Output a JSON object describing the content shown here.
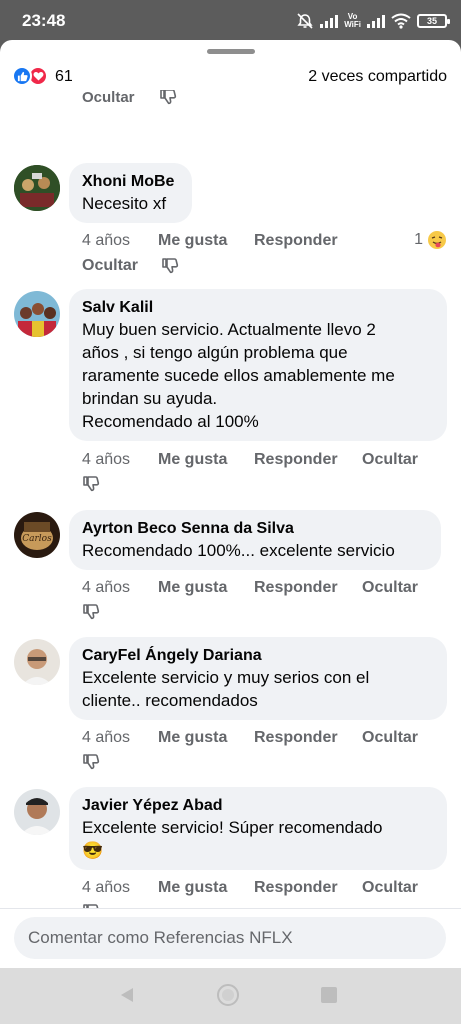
{
  "status_bar": {
    "time": "23:48",
    "vowifi_top": "Vo",
    "vowifi_bottom": "WiFi",
    "battery": "35"
  },
  "reactions": {
    "count": "61",
    "shares": "2 veces compartido"
  },
  "cut_actions": {
    "hide": "Ocultar"
  },
  "comments": [
    {
      "author": "Xhoni MoBe",
      "lines": [
        "Necesito xf"
      ],
      "time": "4 años",
      "like": "Me gusta",
      "reply": "Responder",
      "hide": "Ocultar",
      "reaction_count": "1"
    },
    {
      "author": "Salv Kalil",
      "lines": [
        "Muy buen servicio. Actualmente llevo 2",
        "años , si tengo algún problema que",
        "raramente sucede ellos amablemente me",
        "brindan su ayuda.",
        "Recomendado al 100%"
      ],
      "time": "4 años",
      "like": "Me gusta",
      "reply": "Responder",
      "hide": "Ocultar"
    },
    {
      "author": "Ayrton Beco Senna da Silva",
      "lines": [
        "Recomendado 100%...  excelente servicio"
      ],
      "time": "4 años",
      "like": "Me gusta",
      "reply": "Responder",
      "hide": "Ocultar"
    },
    {
      "author": "CaryFel Ángely Dariana",
      "lines": [
        "Excelente  servicio y muy serios con el",
        "cliente.. recomendados"
      ],
      "time": "4 años",
      "like": "Me gusta",
      "reply": "Responder",
      "hide": "Ocultar"
    },
    {
      "author": "Javier Yépez Abad",
      "lines": [
        "Excelente servicio! Súper recomendado",
        "😎"
      ],
      "time": "4 años",
      "like": "Me gusta",
      "reply": "Responder",
      "hide": "Ocultar"
    }
  ],
  "composer": {
    "placeholder": "Comentar como Referencias NFLX"
  },
  "icons": {
    "like": "like-reaction-icon",
    "love": "love-reaction-icon",
    "dislike": "thumbs-down-icon",
    "back": "back-triangle-icon",
    "home": "home-circle-icon",
    "recent": "recent-apps-square-icon"
  },
  "colors": {
    "accent_blue": "#1877f2",
    "love_red": "#f02849",
    "bubble_bg": "#f0f2f5",
    "meta_gray": "#65676b"
  }
}
